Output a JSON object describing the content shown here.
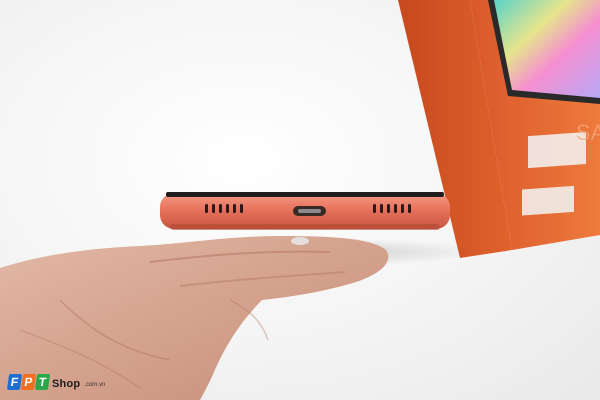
{
  "watermark": {
    "logo_letters": [
      "F",
      "P",
      "T"
    ],
    "shop_label": "Shop",
    "domain_suffix": ".com.vn"
  },
  "box": {
    "side_mark": "SA"
  },
  "colors": {
    "phone_coral": "#e8735c",
    "box_orange": "#e46a2e",
    "logo_f": "#1f6fd1",
    "logo_p": "#f26f21",
    "logo_t": "#2aa84a"
  }
}
